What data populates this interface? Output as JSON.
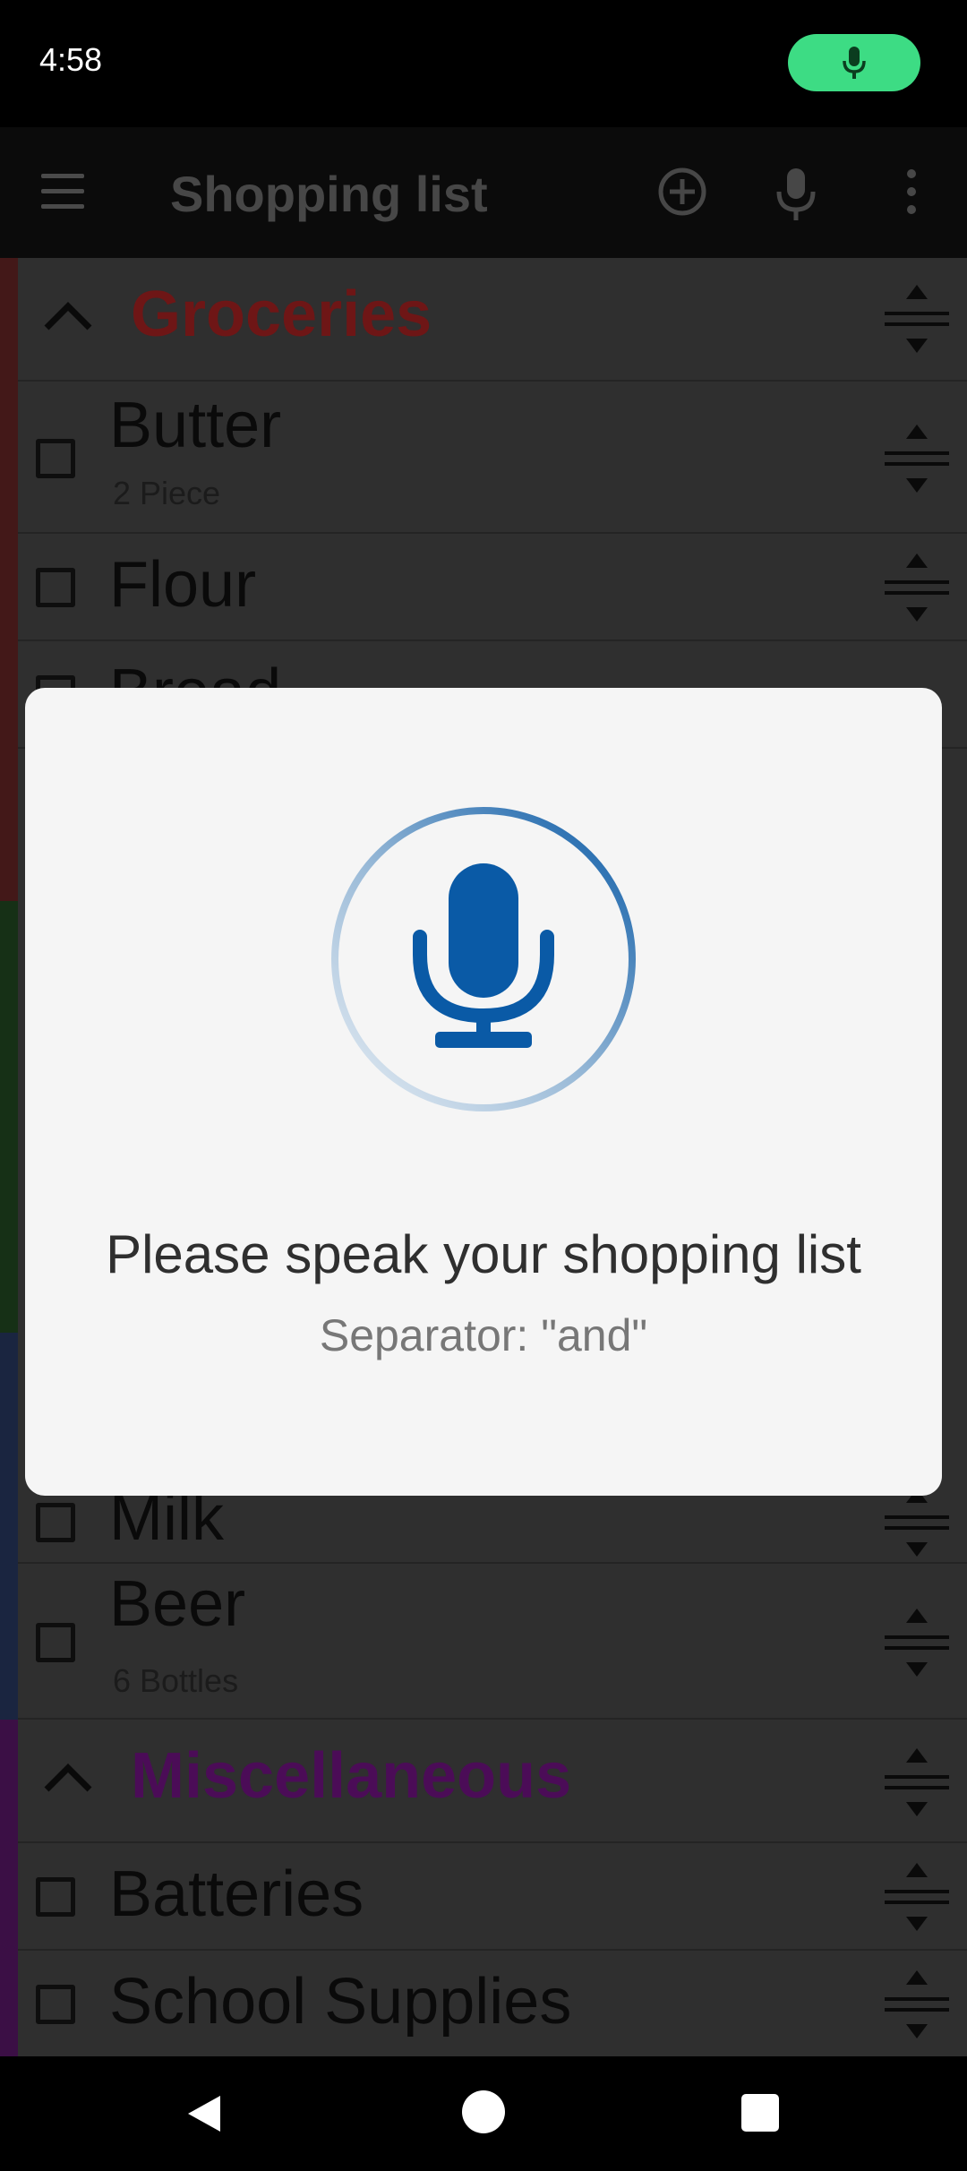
{
  "status_bar": {
    "time": "4:58",
    "mic_indicator_icon": "mic-icon",
    "mic_indicator_color": "#3ddc84"
  },
  "app_bar": {
    "title": "Shopping list",
    "menu_icon": "menu-icon",
    "actions": [
      "add-circle-icon",
      "mic-icon",
      "more-vert-icon"
    ]
  },
  "list": {
    "groceries": {
      "name": "Groceries",
      "color": "#6e1616",
      "items": [
        {
          "name": "Butter",
          "quantity": "2 Piece"
        },
        {
          "name": "Flour"
        },
        {
          "name": "Bread"
        }
      ]
    },
    "drinks_items": [
      {
        "name": "Milk"
      },
      {
        "name": "Beer",
        "quantity": "6 Bottles"
      }
    ],
    "miscellaneous": {
      "name": "Miscellaneous",
      "color": "#4b0c57",
      "items": [
        {
          "name": "Batteries"
        },
        {
          "name": "School Supplies"
        }
      ]
    }
  },
  "dialog": {
    "icon": "mic-icon",
    "prompt": "Please speak your shopping list",
    "separator_hint": "Separator: \"and\"",
    "accent_color": "#0a5aa6"
  },
  "nav_bar": {
    "icons": [
      "back-icon",
      "home-icon",
      "recents-icon"
    ]
  }
}
